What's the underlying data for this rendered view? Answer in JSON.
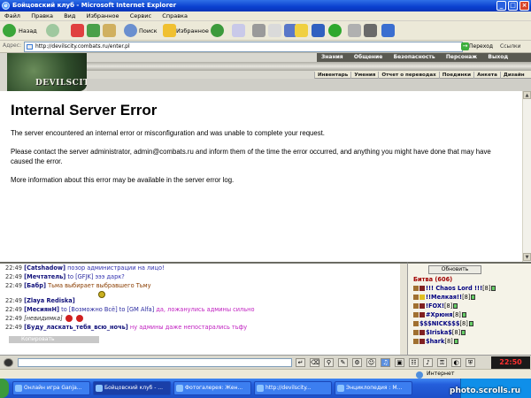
{
  "window": {
    "title": "Бойцовский клуб - Microsoft Internet Explorer"
  },
  "menu": [
    "Файл",
    "Правка",
    "Вид",
    "Избранное",
    "Сервис",
    "Справка"
  ],
  "toolbar": {
    "back": "Назад",
    "search": "Поиск",
    "favorites": "Избранное"
  },
  "address": {
    "label": "Адрес:",
    "url": "http://devilscity.combats.ru/enter.pl",
    "go": "Переход",
    "links": "Ссылки"
  },
  "site": {
    "logo": "DEVILSCITY",
    "topnav": [
      "Знания",
      "Общение",
      "Безопасность",
      "Персонаж",
      "Выход"
    ],
    "subnav": [
      "Инвентарь",
      "Умения",
      "Отчет о переводах",
      "Поединки",
      "Анкета",
      "Дизайн"
    ]
  },
  "error": {
    "title": "Internal Server Error",
    "p1": "The server encountered an internal error or misconfiguration and was unable to complete your request.",
    "p2": "Please contact the server administrator, admin@combats.ru and inform them of the time the error occurred, and anything you might have done that may have caused the error.",
    "p3": "More information about this error may be available in the server error log."
  },
  "chat": {
    "lines": [
      {
        "time": "22:49",
        "user": "[Catshadow]",
        "to": "",
        "text": "позор администрации на лицо!",
        "style": "msg-blue"
      },
      {
        "time": "22:49",
        "user": "[Мечтатель]",
        "to": "to [GFJK]",
        "text": "эээ дарк?",
        "style": "msg-blue"
      },
      {
        "time": "22:49",
        "user": "[Бабр]",
        "to": "",
        "text": "Тьма выбирает выбравшего Тьму",
        "style": "msg-brown"
      },
      {
        "time": "22:49",
        "user": "[Zlaya Rediska]",
        "to": "",
        "text": "",
        "style": "msg-blue"
      },
      {
        "time": "22:49",
        "user": "[МесиянН]",
        "to": "to [Возможно Всё] to [GM Alfa]",
        "text": "да, ложанулись админы сильно",
        "style": "msg-pink"
      },
      {
        "time": "22:49",
        "user": "[невидимка]",
        "to": "",
        "text": "",
        "style": "msg-blue"
      },
      {
        "time": "22:49",
        "user": "[Буду_ласкать_тебя_всю_ночь]",
        "to": "",
        "text": "ну админы даже непостарались тьфу",
        "style": "msg-pink"
      }
    ],
    "copy": "Копировать"
  },
  "battle": {
    "refresh": "Обновить",
    "title": "Битва (606)",
    "players": [
      {
        "name": "!!! Chaos Lord !!!",
        "level": "[8]"
      },
      {
        "name": "!!Мелкая!!",
        "level": "[8]"
      },
      {
        "name": "!FOX!",
        "level": "[8]"
      },
      {
        "name": "#Хрюня",
        "level": "[8]"
      },
      {
        "name": "$$$NICK$$$",
        "level": "[8]"
      },
      {
        "name": "$Iriska$",
        "level": "[8]"
      },
      {
        "name": "$hark",
        "level": "[8]"
      }
    ]
  },
  "clock": "22:50",
  "status": {
    "zone": "Интернет"
  },
  "taskbar": {
    "items": [
      "Онлайн игра Ganja...",
      "Бойцовский клуб - ...",
      "Фотогалерея: Жен...",
      "http://devilscity...",
      "Энциклопедия : М..."
    ]
  },
  "watermark": "photo.scrolls.ru"
}
